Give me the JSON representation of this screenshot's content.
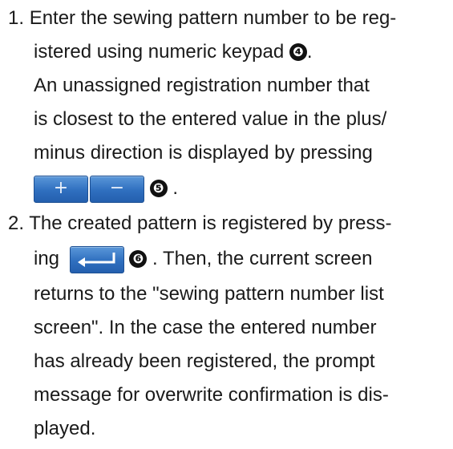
{
  "steps": [
    {
      "number": "1.",
      "lines": [
        "Enter the sewing pattern number to be reg-",
        "istered using numeric keypad",
        "An unassigned registration number that",
        "is closest to the entered value in the plus/",
        "minus direction is displayed by pressing"
      ],
      "marker_a": "❹",
      "marker_a_suffix": ".",
      "buttons_row": {
        "plus_symbol": "+",
        "minus_symbol": "−",
        "marker": "❺",
        "suffix": "."
      }
    },
    {
      "number": "2.",
      "lines": [
        "The created pattern is registered by press-",
        "ing",
        ". Then, the current screen",
        "returns to the \"sewing pattern number list",
        "screen\". In the case the entered number",
        "has already been registered, the prompt",
        "message for overwrite confirmation is dis-",
        "played."
      ],
      "marker": "❻"
    }
  ],
  "icons": {
    "plus_button": "plus-key-icon",
    "minus_button": "minus-key-icon",
    "enter_button": "enter-key-icon"
  },
  "colors": {
    "button_blue": "#2f6fbf",
    "text": "#1a1a1a"
  }
}
